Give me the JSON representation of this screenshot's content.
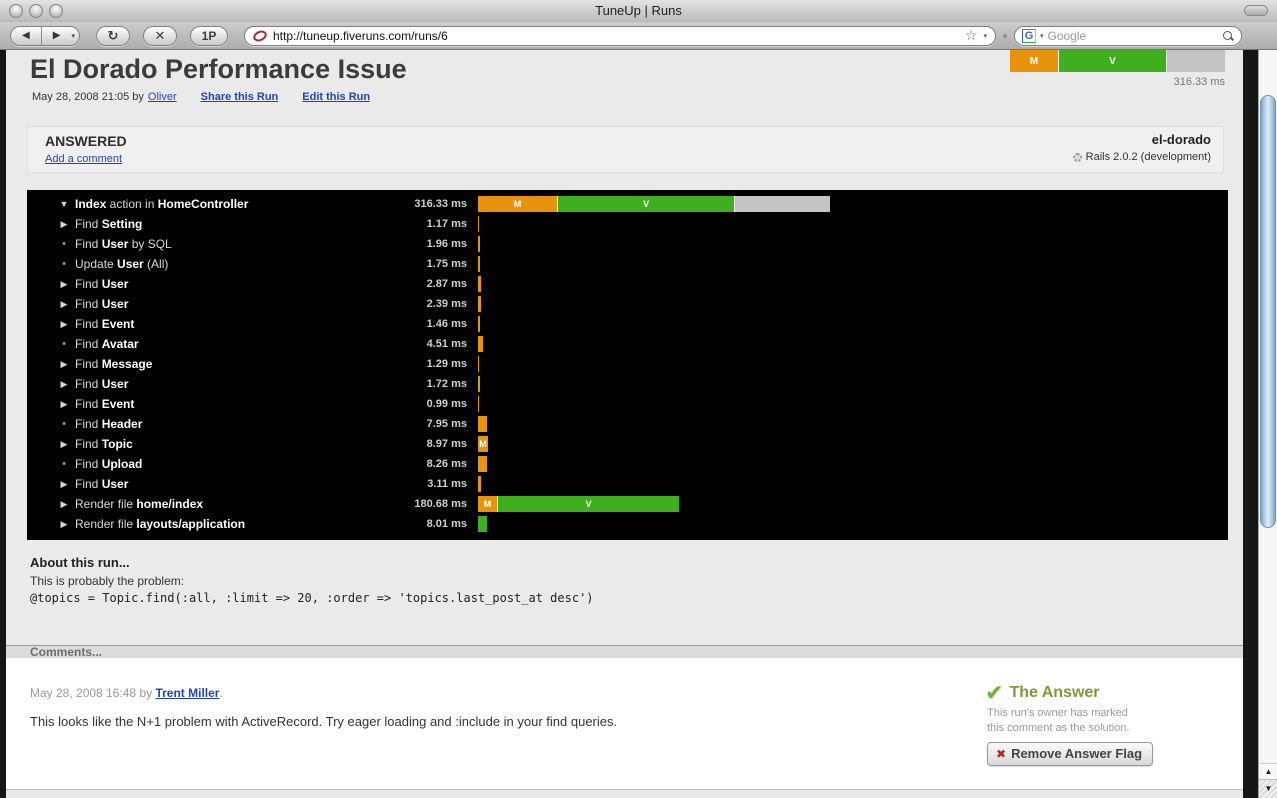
{
  "window": {
    "title": "TuneUp | Runs"
  },
  "toolbar": {
    "back_icon": "◀",
    "forward_icon": "▶",
    "reload_icon": "↻",
    "stop_icon": "✕",
    "onepassword_label": "1P",
    "url": "http://tuneup.fiveruns.com/runs/6",
    "star_icon": "☆",
    "search_placeholder": "Google",
    "glogo_letter": "G"
  },
  "colors": {
    "measure": "#E8930C",
    "view": "#3FAE1F",
    "other": "#C4C4C4"
  },
  "page": {
    "title": "El Dorado Performance Issue",
    "meta": {
      "date_text": "May 28, 2008 21:05 by",
      "author": "Oliver",
      "share": "Share this Run",
      "edit": "Edit this Run"
    },
    "header_bar": {
      "total_text": "316.33 ms",
      "total_ms": 316.33,
      "segments": [
        {
          "code": "M",
          "ms": 72,
          "show_label": true
        },
        {
          "code": "V",
          "ms": 159,
          "show_label": true
        },
        {
          "code": "O",
          "ms": 85.33,
          "show_label": false
        }
      ]
    },
    "status": {
      "answered": "ANSWERED",
      "add_comment": "Add a comment",
      "app": "el-dorado",
      "rails": "Rails 2.0.2 (development)"
    },
    "timeline": {
      "rows": [
        {
          "bullet": "open",
          "label": "**Index** action in **HomeController**",
          "ms_text": "316.33 ms",
          "segments": [
            {
              "code": "M",
              "ms": 72,
              "show_label": true
            },
            {
              "code": "V",
              "ms": 159,
              "show_label": true
            },
            {
              "code": "O",
              "ms": 85.33,
              "show_label": false
            }
          ]
        },
        {
          "bullet": "closed",
          "label": "Find **Setting**",
          "ms_text": "1.17 ms",
          "segments": [
            {
              "code": "M",
              "ms": 1.17,
              "show_label": false
            }
          ]
        },
        {
          "bullet": "leaf",
          "label": "Find **User** by SQL",
          "ms_text": "1.96 ms",
          "segments": [
            {
              "code": "M",
              "ms": 1.96,
              "show_label": false
            }
          ]
        },
        {
          "bullet": "leaf",
          "label": "Update **User** (All)",
          "ms_text": "1.75 ms",
          "segments": [
            {
              "code": "M",
              "ms": 1.75,
              "show_label": false
            }
          ]
        },
        {
          "bullet": "closed",
          "label": "Find **User**",
          "ms_text": "2.87 ms",
          "segments": [
            {
              "code": "M",
              "ms": 2.87,
              "show_label": false
            }
          ]
        },
        {
          "bullet": "closed",
          "label": "Find **User**",
          "ms_text": "2.39 ms",
          "segments": [
            {
              "code": "M",
              "ms": 2.39,
              "show_label": false
            }
          ]
        },
        {
          "bullet": "closed",
          "label": "Find **Event**",
          "ms_text": "1.46 ms",
          "segments": [
            {
              "code": "M",
              "ms": 1.46,
              "show_label": false
            }
          ]
        },
        {
          "bullet": "leaf",
          "label": "Find **Avatar**",
          "ms_text": "4.51 ms",
          "segments": [
            {
              "code": "M",
              "ms": 4.51,
              "show_label": false
            }
          ]
        },
        {
          "bullet": "closed",
          "label": "Find **Message**",
          "ms_text": "1.29 ms",
          "segments": [
            {
              "code": "M",
              "ms": 1.29,
              "show_label": false
            }
          ]
        },
        {
          "bullet": "closed",
          "label": "Find **User**",
          "ms_text": "1.72 ms",
          "segments": [
            {
              "code": "M",
              "ms": 1.72,
              "show_label": false
            }
          ]
        },
        {
          "bullet": "closed",
          "label": "Find **Event**",
          "ms_text": "0.99 ms",
          "segments": [
            {
              "code": "M",
              "ms": 0.99,
              "show_label": false
            }
          ]
        },
        {
          "bullet": "leaf",
          "label": "Find **Header**",
          "ms_text": "7.95 ms",
          "segments": [
            {
              "code": "M",
              "ms": 7.95,
              "show_label": false
            }
          ]
        },
        {
          "bullet": "closed",
          "label": "Find **Topic**",
          "ms_text": "8.97 ms",
          "segments": [
            {
              "code": "M",
              "ms": 8.97,
              "show_label": true
            }
          ]
        },
        {
          "bullet": "leaf",
          "label": "Find **Upload**",
          "ms_text": "8.26 ms",
          "segments": [
            {
              "code": "M",
              "ms": 8.26,
              "show_label": false
            }
          ]
        },
        {
          "bullet": "closed",
          "label": "Find **User**",
          "ms_text": "3.11 ms",
          "segments": [
            {
              "code": "M",
              "ms": 3.11,
              "show_label": false
            }
          ]
        },
        {
          "bullet": "closed",
          "label": "Render file **home/index**",
          "ms_text": "180.68 ms",
          "segments": [
            {
              "code": "M",
              "ms": 18,
              "show_label": true
            },
            {
              "code": "V",
              "ms": 162.68,
              "show_label": true
            }
          ]
        },
        {
          "bullet": "closed",
          "label": "Render file **layouts/application**",
          "ms_text": "8.01 ms",
          "segments": [
            {
              "code": "V",
              "ms": 8.01,
              "show_label": false
            }
          ]
        }
      ]
    },
    "about": {
      "heading": "About this run...",
      "line": "This is probably the problem:",
      "code": "@topics = Topic.find(:all, :limit => 20, :order => 'topics.last_post_at desc')"
    },
    "comments": {
      "heading": "Comments...",
      "meta_prefix": "May 28, 2008 16:48 by",
      "author": "Trent Miller",
      "meta_suffix": ".",
      "body": "This looks like the N+1 problem with ActiveRecord. Try eager loading and :include in your find queries."
    },
    "answer": {
      "check_icon": "✔",
      "title": "The Answer",
      "line1": "This run's owner has marked",
      "line2": "this comment as the solution.",
      "button_icon": "✖",
      "button_label": "Remove Answer Flag"
    }
  }
}
